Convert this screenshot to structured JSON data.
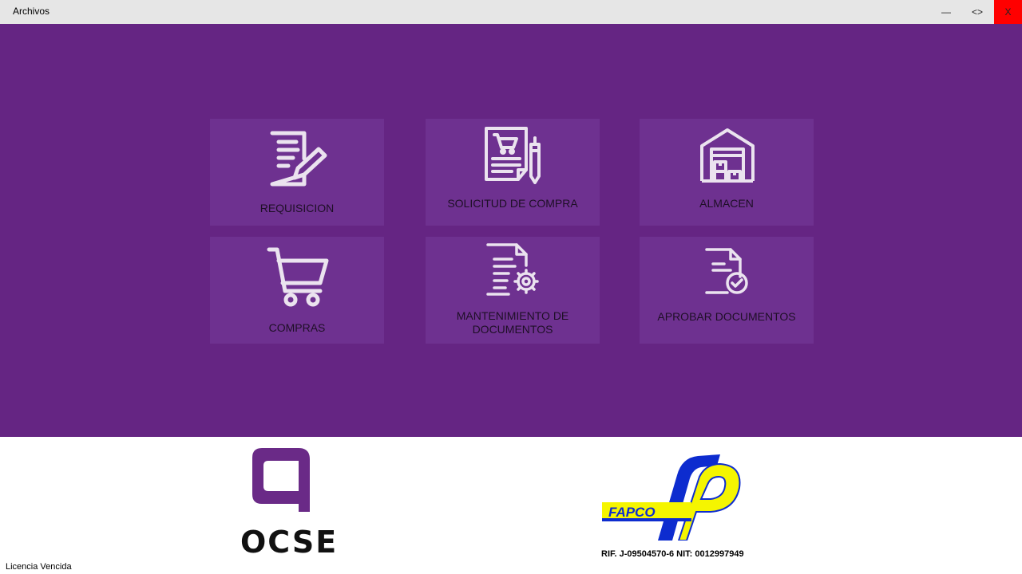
{
  "window": {
    "title": "Archivos",
    "minimize_label": "—",
    "restore_label": "<>",
    "close_label": "X"
  },
  "menu": {
    "tiles": [
      {
        "label": "REQUISICION",
        "icon": "document-edit-icon"
      },
      {
        "label": "SOLICITUD DE COMPRA",
        "icon": "purchase-request-icon"
      },
      {
        "label": "ALMACEN",
        "icon": "warehouse-icon"
      },
      {
        "label": "COMPRAS",
        "icon": "shopping-cart-icon"
      },
      {
        "label": "MANTENIMIENTO DE DOCUMENTOS",
        "icon": "document-settings-icon"
      },
      {
        "label": "APROBAR DOCUMENTOS",
        "icon": "document-approve-icon"
      }
    ]
  },
  "footer": {
    "ocse_logo_text": "OCSE",
    "fapco_logo_text": "FAPCO",
    "company_id": "RIF. J-09504570-6 NIT: 0012997949",
    "status": "Licencia Vencida"
  },
  "colors": {
    "main_background": "#652583",
    "tile_background": "#6e3190",
    "close_button": "#ff0000",
    "fapco_blue": "#0d2ccf",
    "fapco_yellow": "#f5f500"
  }
}
